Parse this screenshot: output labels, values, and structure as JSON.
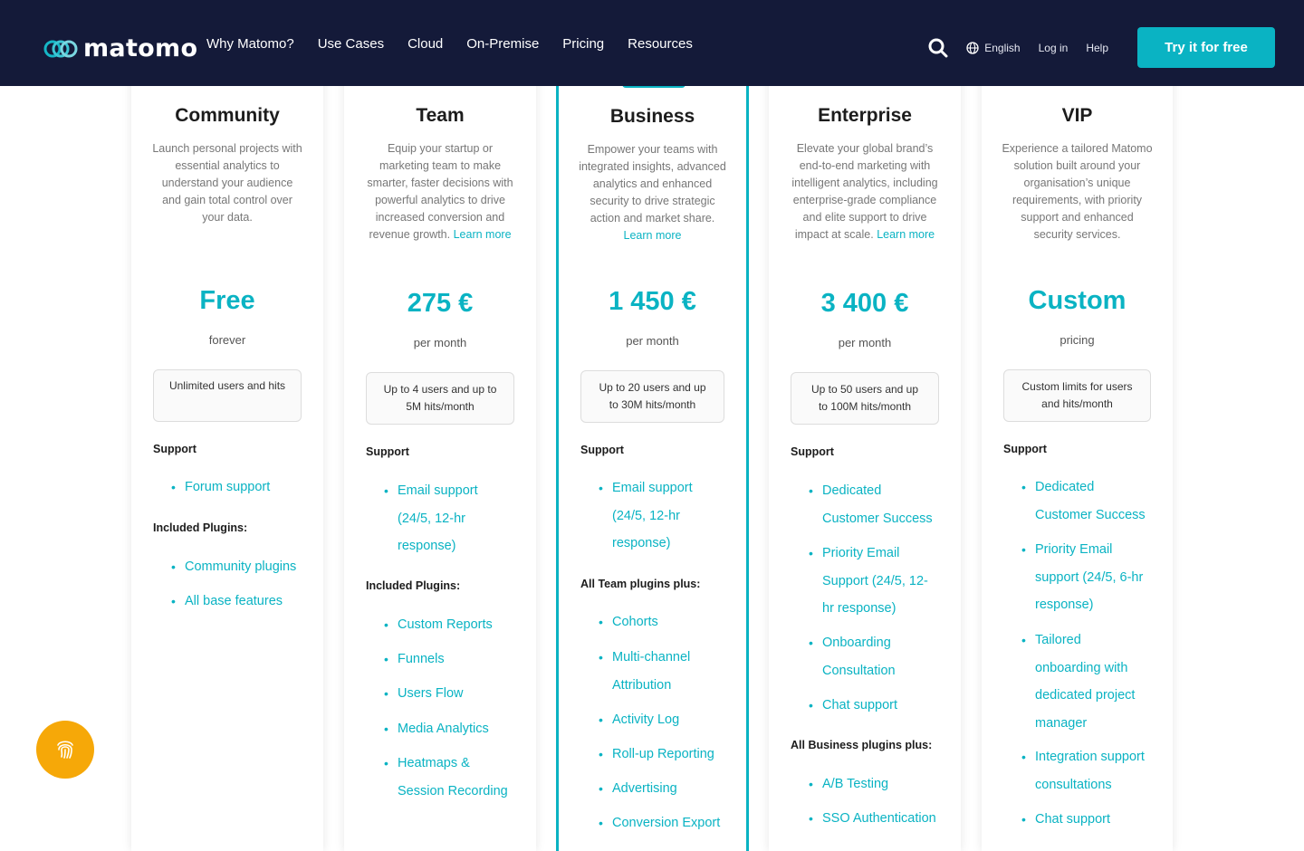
{
  "header": {
    "logo_text": "matomo",
    "nav": [
      "Why Matomo?",
      "Use Cases",
      "Cloud",
      "On-Premise",
      "Pricing",
      "Resources"
    ],
    "language": "English",
    "login": "Log in",
    "help": "Help",
    "cta": "Try it for free"
  },
  "plans": [
    {
      "name": "Community",
      "description": "Launch personal projects with essential analytics to understand your audience and gain total control over your data.",
      "learn_more": "",
      "price": "Free",
      "period": "forever",
      "limits": "Unlimited users and hits",
      "support_title": "Support",
      "support": [
        "Forum support"
      ],
      "plugins_title": "Included Plugins:",
      "plugins": [
        "Community plugins",
        "All base features"
      ]
    },
    {
      "name": "Team",
      "description": "Equip your startup or marketing team to make smarter, faster decisions with powerful analytics to drive increased conversion and revenue growth.",
      "learn_more": "Learn more",
      "price": "275 €",
      "period": "per month",
      "limits": "Up to 4 users and up to 5M hits/month",
      "support_title": "Support",
      "support": [
        "Email support (24/5, 12-hr response)"
      ],
      "plugins_title": "Included Plugins:",
      "plugins": [
        "Custom Reports",
        "Funnels",
        "Users Flow",
        "Media Analytics",
        "Heatmaps & Session Recording"
      ]
    },
    {
      "name": "Business",
      "description": "Empower your teams with integrated insights, advanced analytics and enhanced security to drive strategic action and market share.",
      "learn_more": "Learn more",
      "price": "1 450 €",
      "period": "per month",
      "limits": "Up to 20 users and up to 30M hits/month",
      "support_title": "Support",
      "support": [
        "Email support (24/5, 12-hr response)"
      ],
      "plugins_title": "All Team plugins plus:",
      "plugins": [
        "Cohorts",
        "Multi-channel Attribution",
        "Activity Log",
        "Roll-up Reporting",
        "Advertising",
        "Conversion Export"
      ]
    },
    {
      "name": "Enterprise",
      "description": "Elevate your global brand’s end-to-end marketing with intelligent analytics, including enterprise-grade compliance and elite support to drive impact at scale.",
      "learn_more": "Learn more",
      "price": "3 400 €",
      "period": "per month",
      "limits": "Up to 50 users and up to 100M hits/month",
      "support_title": "Support",
      "support": [
        "Dedicated Customer Success",
        "Priority Email Support (24/5, 12-hr response)",
        "Onboarding Consultation",
        "Chat support"
      ],
      "plugins_title": "All Business plugins plus:",
      "plugins": [
        "A/B Testing",
        "SSO Authentication"
      ]
    },
    {
      "name": "VIP",
      "description": "Experience a tailored Matomo solution built around your organisation’s unique requirements, with priority support and enhanced security services.",
      "learn_more": "",
      "price": "Custom",
      "period": "pricing",
      "limits": "Custom limits for users and hits/month",
      "support_title": "Support",
      "support": [
        "Dedicated Customer Success",
        "Priority Email support (24/5, 6-hr response)",
        "Tailored onboarding with dedicated project manager",
        "Integration support consultations",
        "Chat support"
      ],
      "plugins_title": "",
      "plugins": []
    }
  ],
  "colors": {
    "header_bg": "#141a39",
    "accent": "#0ab3c3",
    "fab": "#f6a808"
  },
  "fab_icon": "fingerprint-icon"
}
